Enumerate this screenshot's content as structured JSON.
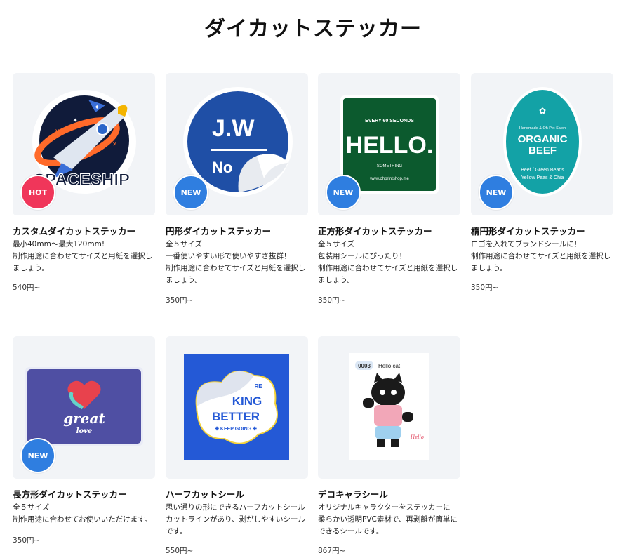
{
  "page": {
    "title": "ダイカットステッカー"
  },
  "products": [
    {
      "name": "カスタムダイカットステッカー",
      "badge": "HOT",
      "desc": [
        "最小40mm～最大120mm!",
        "制作用途に合わせてサイズと用紙を選択しましょう。"
      ],
      "price": "540円~",
      "art_text": "SPACESHIP"
    },
    {
      "name": "円形ダイカットステッカー",
      "badge": "NEW",
      "desc": [
        "全５サイズ",
        "一番使いやすい形で使いやすさ抜群！",
        "制作用途に合わせてサイズと用紙を選択しましょう。"
      ],
      "price": "350円~",
      "art_text": "J.W",
      "art_text2": "No"
    },
    {
      "name": "正方形ダイカットステッカー",
      "badge": "NEW",
      "desc": [
        "全５サイズ",
        "包装用シールにぴったり！",
        "制作用途に合わせてサイズと用紙を選択しましょう。"
      ],
      "price": "350円~",
      "art_top": "EVERY 60 SECONDS",
      "art_text": "HELLO.",
      "art_sub": "SOMETHING",
      "art_url": "www.ohprintshop.me"
    },
    {
      "name": "楕円形ダイカットステッカー",
      "badge": "NEW",
      "desc": [
        "ロゴを入れてブランドシールに！",
        "制作用途に合わせてサイズと用紙を選択しましょう。"
      ],
      "price": "350円~",
      "art_top": "Handmade & Oh Pet Salon",
      "art_text": "ORGANIC",
      "art_text2": "BEEF",
      "art_sub": "Beef / Green Beans",
      "art_sub2": "Yellow Peas & Chia"
    },
    {
      "name": "長方形ダイカットステッカー",
      "badge": "NEW",
      "desc": [
        "全５サイズ",
        "制作用途に合わせてお使いいただけます。"
      ],
      "price": "350円~",
      "art_text": "great",
      "art_text2": "love"
    },
    {
      "name": "ハーフカットシール",
      "badge": "",
      "desc": [
        "思い通りの形にできるハーフカットシール",
        "カットラインがあり、剥がしやすいシールです。"
      ],
      "price": "550円~",
      "art_top": "RE",
      "art_text": "KING",
      "art_text2": "BETTER",
      "art_sub": "✚ KEEP GOING ✚"
    },
    {
      "name": "デコキャラシール",
      "badge": "",
      "desc": [
        "オリジナルキャラクターをステッカーに",
        "柔らかい透明PVC素材で、再剥離が簡単にできるシールです。"
      ],
      "price": "867円~",
      "art_top": "0003",
      "art_text": "Hello cat",
      "art_sub": "Hello"
    }
  ],
  "colors": {
    "new_badge": "#2f7ee0",
    "hot_badge": "#f0365a",
    "card_bg": "#f2f4f7"
  }
}
